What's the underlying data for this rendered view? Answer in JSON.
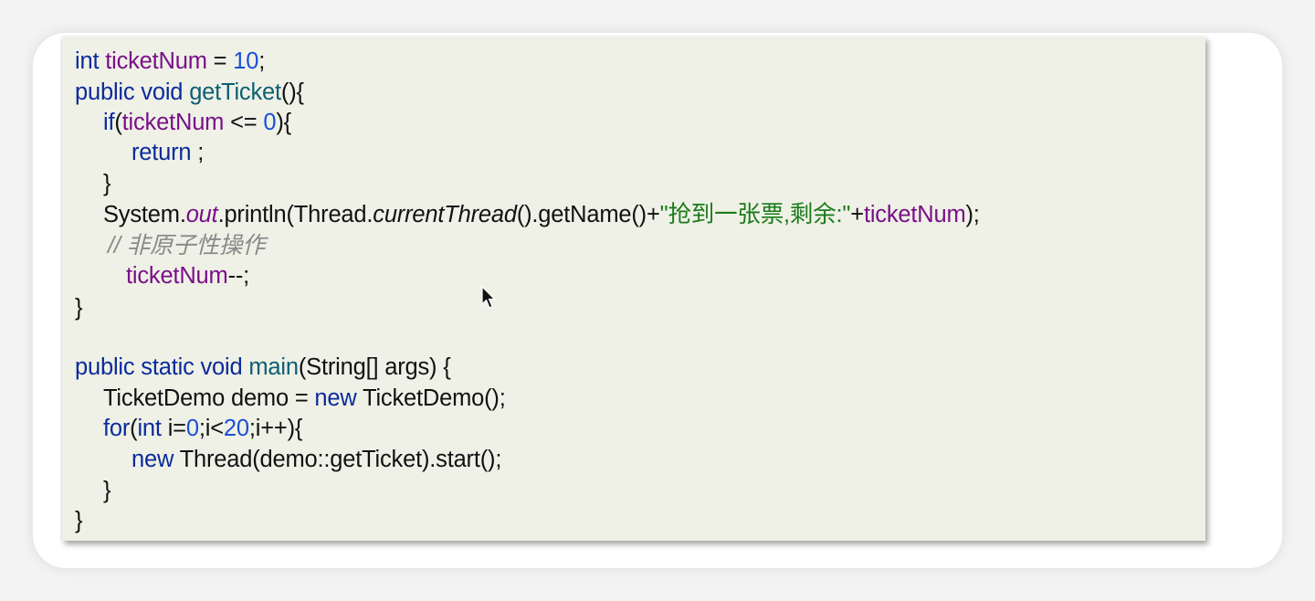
{
  "colors": {
    "keyword": "#0a2a9c",
    "field": "#7a0f8a",
    "number": "#1a4fd6",
    "method": "#0c5e74",
    "string": "#1b7a1b",
    "comment": "#8a8a8a",
    "panel_bg": "#eff1e6"
  },
  "code": {
    "l1": {
      "t1": "int",
      "t2": " ",
      "t3": "ticketNum",
      "t4": " = ",
      "t5": "10",
      "t6": ";"
    },
    "l2": {
      "t1": "public void",
      "t2": " ",
      "t3": "getTicket",
      "t4": "(){"
    },
    "l3": {
      "t1": "if",
      "t2": "(",
      "t3": "ticketNum",
      "t4": " <= ",
      "t5": "0",
      "t6": "){"
    },
    "l4": {
      "t1": "return",
      "t2": " ;"
    },
    "l5": {
      "t1": "}"
    },
    "l6": {
      "t1": "System.",
      "t2": "out",
      "t3": ".println(Thread.",
      "t4": "currentThread",
      "t5": "().getName()+",
      "t6": "\"抢到一张票,剩余:\"",
      "t7": "+",
      "t8": "ticketNum",
      "t9": ");"
    },
    "l7": {
      "t1": "// 非原子性操作"
    },
    "l8": {
      "t1": "ticketNum",
      "t2": "--;"
    },
    "l9": {
      "t1": "}"
    },
    "l10": {
      "t1": "public static void",
      "t2": " ",
      "t3": "main",
      "t4": "(String[] args) {"
    },
    "l11": {
      "t1": "TicketDemo demo = ",
      "t2": "new",
      "t3": " TicketDemo();"
    },
    "l12": {
      "t1": "for",
      "t2": "(",
      "t3": "int",
      "t4": " i=",
      "t5": "0",
      "t6": ";i<",
      "t7": "20",
      "t8": ";i++){"
    },
    "l13": {
      "t1": "new",
      "t2": " Thread(demo::getTicket).start();"
    },
    "l14": {
      "t1": "}"
    },
    "l15": {
      "t1": "}"
    }
  },
  "cursor_icon": "mouse-pointer-icon"
}
